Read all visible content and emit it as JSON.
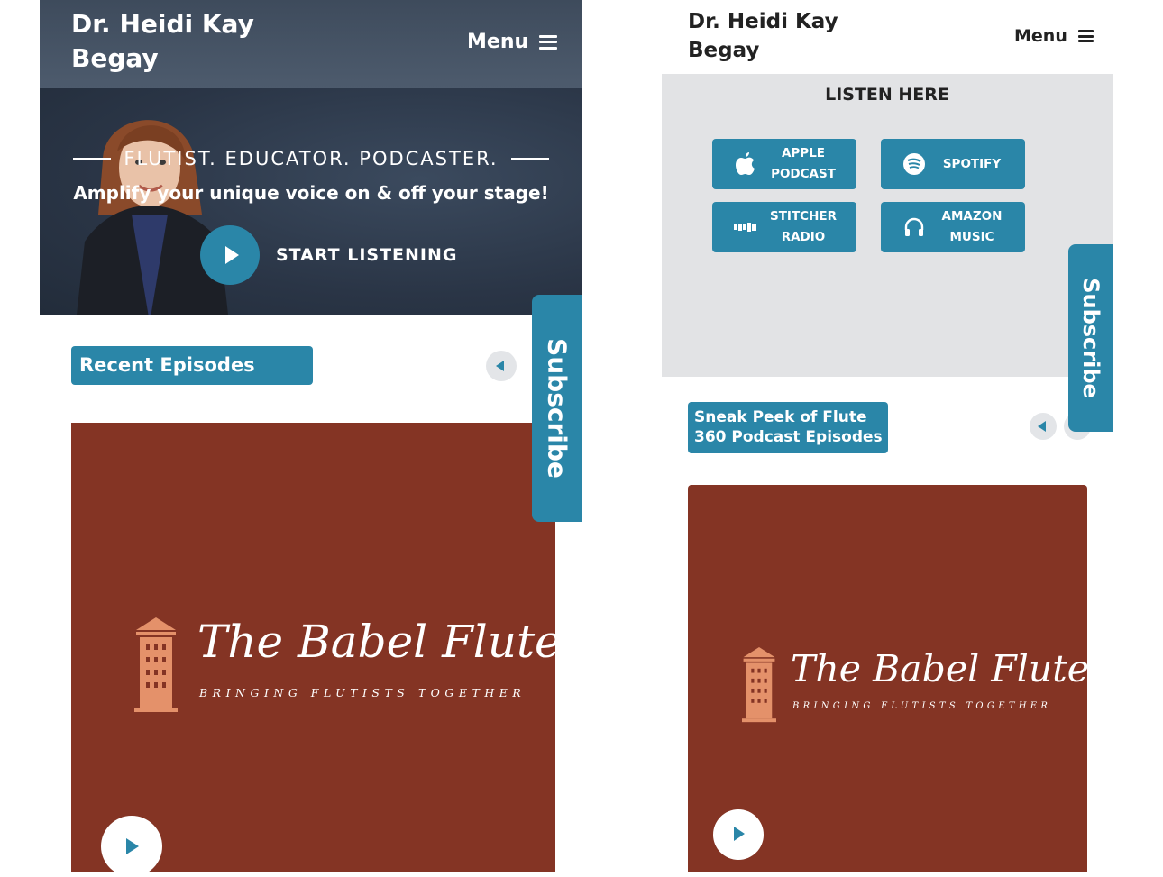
{
  "left": {
    "header": {
      "title": "Dr. Heidi Kay\nBegay",
      "menu_label": "Menu"
    },
    "hero": {
      "tagline": "FLUTIST. EDUCATOR. PODCASTER.",
      "headline": "Amplify your unique voice on & off your stage!",
      "cta_label": "START LISTENING"
    },
    "recent_label": "Recent Episodes",
    "cover": {
      "title": "The Babel Flute",
      "subtitle": "BRINGING FLUTISTS TOGETHER"
    },
    "subscribe_label": "Subscribe"
  },
  "right": {
    "header": {
      "title": "Dr. Heidi Kay\nBegay",
      "menu_label": "Menu"
    },
    "listen_heading": "LISTEN HERE",
    "services": [
      {
        "label": "APPLE\nPODCAST",
        "icon": "apple-icon"
      },
      {
        "label": "SPOTIFY",
        "icon": "spotify-icon"
      },
      {
        "label": "STITCHER\nRADIO",
        "icon": "stitcher-icon"
      },
      {
        "label": "AMAZON\nMUSIC",
        "icon": "headphones-icon"
      }
    ],
    "sneak_label": "Sneak Peek of Flute\n360 Podcast Episodes",
    "cover": {
      "title": "The Babel Flute",
      "subtitle": "BRINGING FLUTISTS TOGETHER"
    },
    "subscribe_label": "Subscribe"
  },
  "colors": {
    "accent": "#2a86a8",
    "cover_bg": "#843424",
    "tower": "#e4916a",
    "header_bg": "#45525f",
    "panel_bg": "#e2e3e5"
  }
}
